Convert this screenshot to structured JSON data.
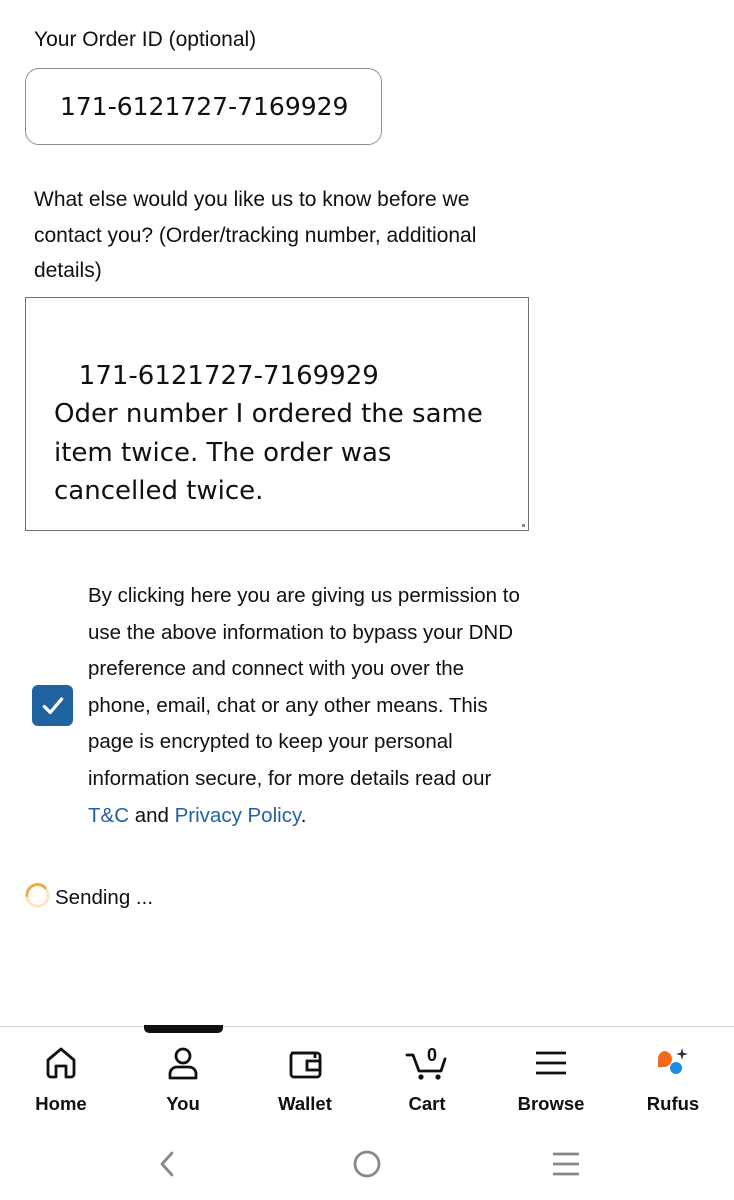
{
  "form": {
    "order_id_label": "Your Order ID (optional)",
    "order_id_value": "171-6121727-7169929",
    "details_label": "What else would you like us to know before we contact you? (Order/tracking number, additional details)",
    "details_value": " 171-6121727-7169929\nOder number I ordered the same item twice. The order was cancelled twice."
  },
  "consent": {
    "checked": true,
    "text": "By clicking here you are giving us permission to use the above information to bypass your DND preference and connect with you over the phone, email, chat or any other means. This page is encrypted to keep your personal information secure, for more details read our ",
    "tc_link": "T&C",
    "and_text": " and ",
    "privacy_link": "Privacy Policy",
    "end_text": "."
  },
  "status": {
    "sending_text": "Sending ..."
  },
  "bottom_nav": {
    "active": "You",
    "items": [
      {
        "label": "Home",
        "icon": "home-icon"
      },
      {
        "label": "You",
        "icon": "person-icon"
      },
      {
        "label": "Wallet",
        "icon": "wallet-icon"
      },
      {
        "label": "Cart",
        "icon": "cart-icon",
        "badge": "0"
      },
      {
        "label": "Browse",
        "icon": "menu-icon"
      },
      {
        "label": "Rufus",
        "icon": "rufus-icon"
      }
    ]
  },
  "system_nav": {
    "buttons": [
      "back-icon",
      "home-circle-icon",
      "recents-icon"
    ]
  },
  "colors": {
    "link": "#2162a1",
    "checkbox": "#2162a1",
    "spinner": "#f3a847",
    "rufus_orange": "#f26b1d",
    "rufus_blue": "#1a8fe3"
  }
}
